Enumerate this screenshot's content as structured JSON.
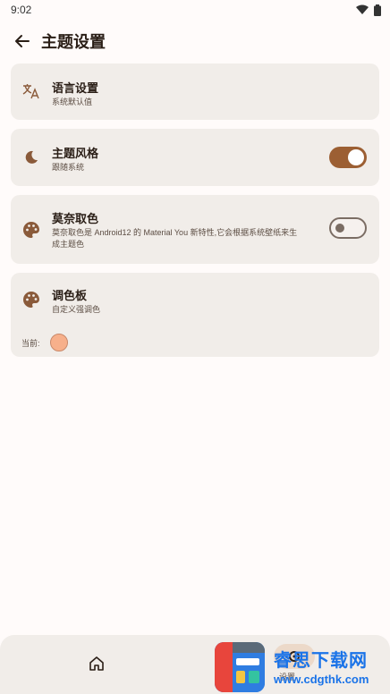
{
  "status_bar": {
    "time": "9:02"
  },
  "app_bar": {
    "title": "主题设置"
  },
  "settings": [
    {
      "title": "语言设置",
      "subtitle": "系统默认值"
    },
    {
      "title": "主题风格",
      "subtitle": "跟随系统",
      "switch_on": true
    },
    {
      "title": "莫奈取色",
      "subtitle_line1": "莫奈取色是 Android12 的 Material You 新特性,它会根据系统壁纸来生",
      "subtitle_line2": "成主题色",
      "switch_on": false
    },
    {
      "title": "调色板",
      "subtitle": "自定义强调色",
      "current_label": "当前:",
      "current_color": "#f7b08b"
    }
  ],
  "bottom_nav": {
    "settings_label": "设置"
  },
  "watermark": {
    "line1": "睿思下载网",
    "line2": "www.cdgthk.com"
  },
  "colors": {
    "accent": "#9c5f33",
    "card_bg": "#f1ede9",
    "page_bg": "#fffbfa"
  }
}
